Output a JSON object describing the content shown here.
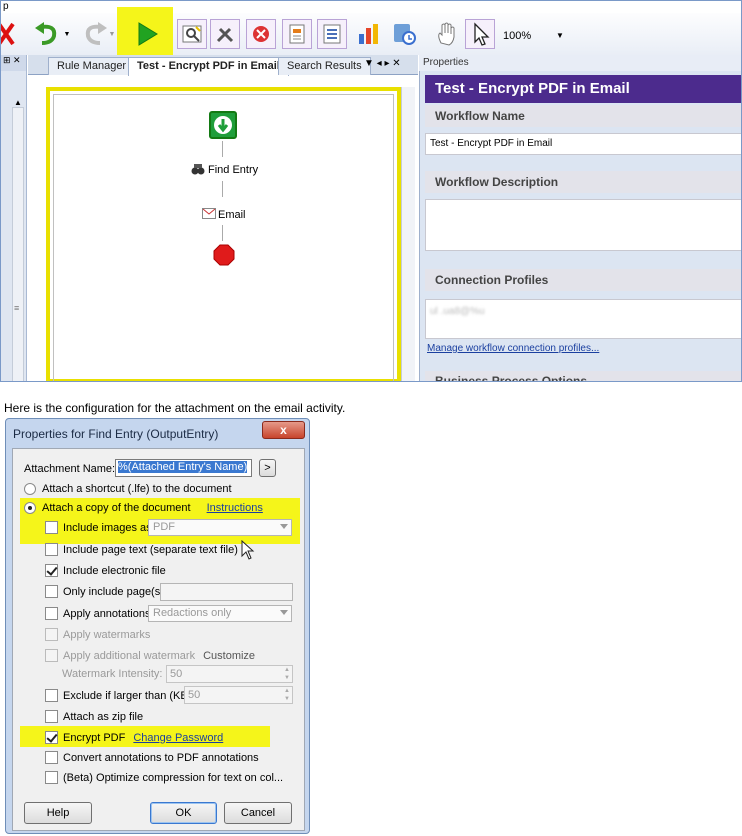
{
  "app": {
    "corner_letter": "p",
    "zoom": "100%",
    "tabs": [
      "Rule Manager",
      "Test - Encrypt PDF in Email",
      "Search Results"
    ],
    "workflow_nodes": [
      "Find Entry",
      "Email"
    ],
    "properties": {
      "header": "Properties",
      "title": "Test - Encrypt PDF in Email",
      "name_label": "Workflow Name",
      "name_value": "Test - Encrypt PDF in Email",
      "desc_label": "Workflow Description",
      "conn_label": "Connection Profiles",
      "conn_value": "ul .ua8@%u",
      "manage_link": "Manage workflow connection profiles...",
      "bpo_label": "Business Process Options"
    }
  },
  "caption": "Here is the configuration for the attachment on the email activity.",
  "dialog": {
    "title": "Properties for Find Entry (OutputEntry)",
    "close": "x",
    "attachment_name_label": "Attachment Name:",
    "attachment_name_value": "%(Attached Entry's Name)",
    "attach_shortcut": "Attach a shortcut (.lfe) to the document",
    "attach_copy": "Attach a copy of the document",
    "instructions": "Instructions",
    "include_images": "Include images as:",
    "images_format": "PDF",
    "include_page_text": "Include page text (separate text file)",
    "include_electronic": "Include electronic file",
    "only_include_pages": "Only include page(s):",
    "apply_annotations": "Apply annotations:",
    "annotations_option": "Redactions only",
    "apply_watermarks": "Apply watermarks",
    "apply_additional_watermark": "Apply additional watermark",
    "customize": "Customize",
    "watermark_intensity_label": "Watermark Intensity:",
    "watermark_intensity": "50",
    "exclude_if_larger": "Exclude if larger than (KB):",
    "exclude_value": "50",
    "attach_zip": "Attach as zip file",
    "encrypt_pdf": "Encrypt PDF",
    "change_password": "Change Password",
    "convert_annotations": "Convert annotations to PDF annotations",
    "beta_optimize": "(Beta) Optimize compression for text on col...",
    "help": "Help",
    "ok": "OK",
    "cancel": "Cancel",
    "browse": ">"
  },
  "colors": {
    "highlight": "#f5f51a",
    "purple_header": "#4c2b8d",
    "link": "#1a3fa0"
  }
}
